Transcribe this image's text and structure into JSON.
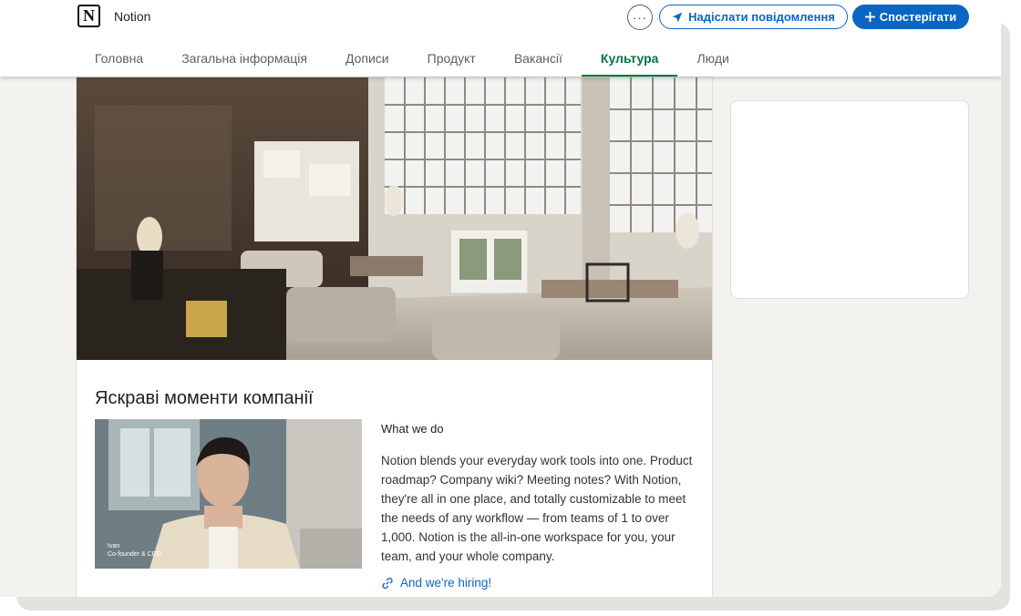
{
  "header": {
    "logo_letter": "N",
    "company_name": "Notion",
    "more_glyph": "···",
    "message_button": "Надіслати повідомлення",
    "follow_button": "Спостерігати"
  },
  "tabs": [
    {
      "label": "Головна"
    },
    {
      "label": "Загальна інформація"
    },
    {
      "label": "Дописи"
    },
    {
      "label": "Продукт"
    },
    {
      "label": "Вакансії"
    },
    {
      "label": "Культура",
      "active": true
    },
    {
      "label": "Люди"
    }
  ],
  "highlights": {
    "title": "Яскраві моменти компанії",
    "video": {
      "person_name": "Ivan",
      "person_role": "Co-founder & CEO"
    },
    "what_we_do_title": "What we do",
    "what_we_do_text": "Notion blends your everyday work tools into one. Product roadmap? Company wiki? Meeting notes? With Notion, they're all in one place, and totally customizable to meet the needs of any workflow — from teams of 1 to over 1,000. Notion is the all-in-one workspace for you, your team, and your whole company.",
    "hiring_link": "And we're hiring!"
  },
  "colors": {
    "brand_blue": "#0a66c2",
    "active_tab_green": "#057642",
    "page_bg": "#f3f2ef"
  },
  "icons": [
    "notion-logo",
    "more-icon",
    "send-icon",
    "plus-icon",
    "link-icon"
  ]
}
